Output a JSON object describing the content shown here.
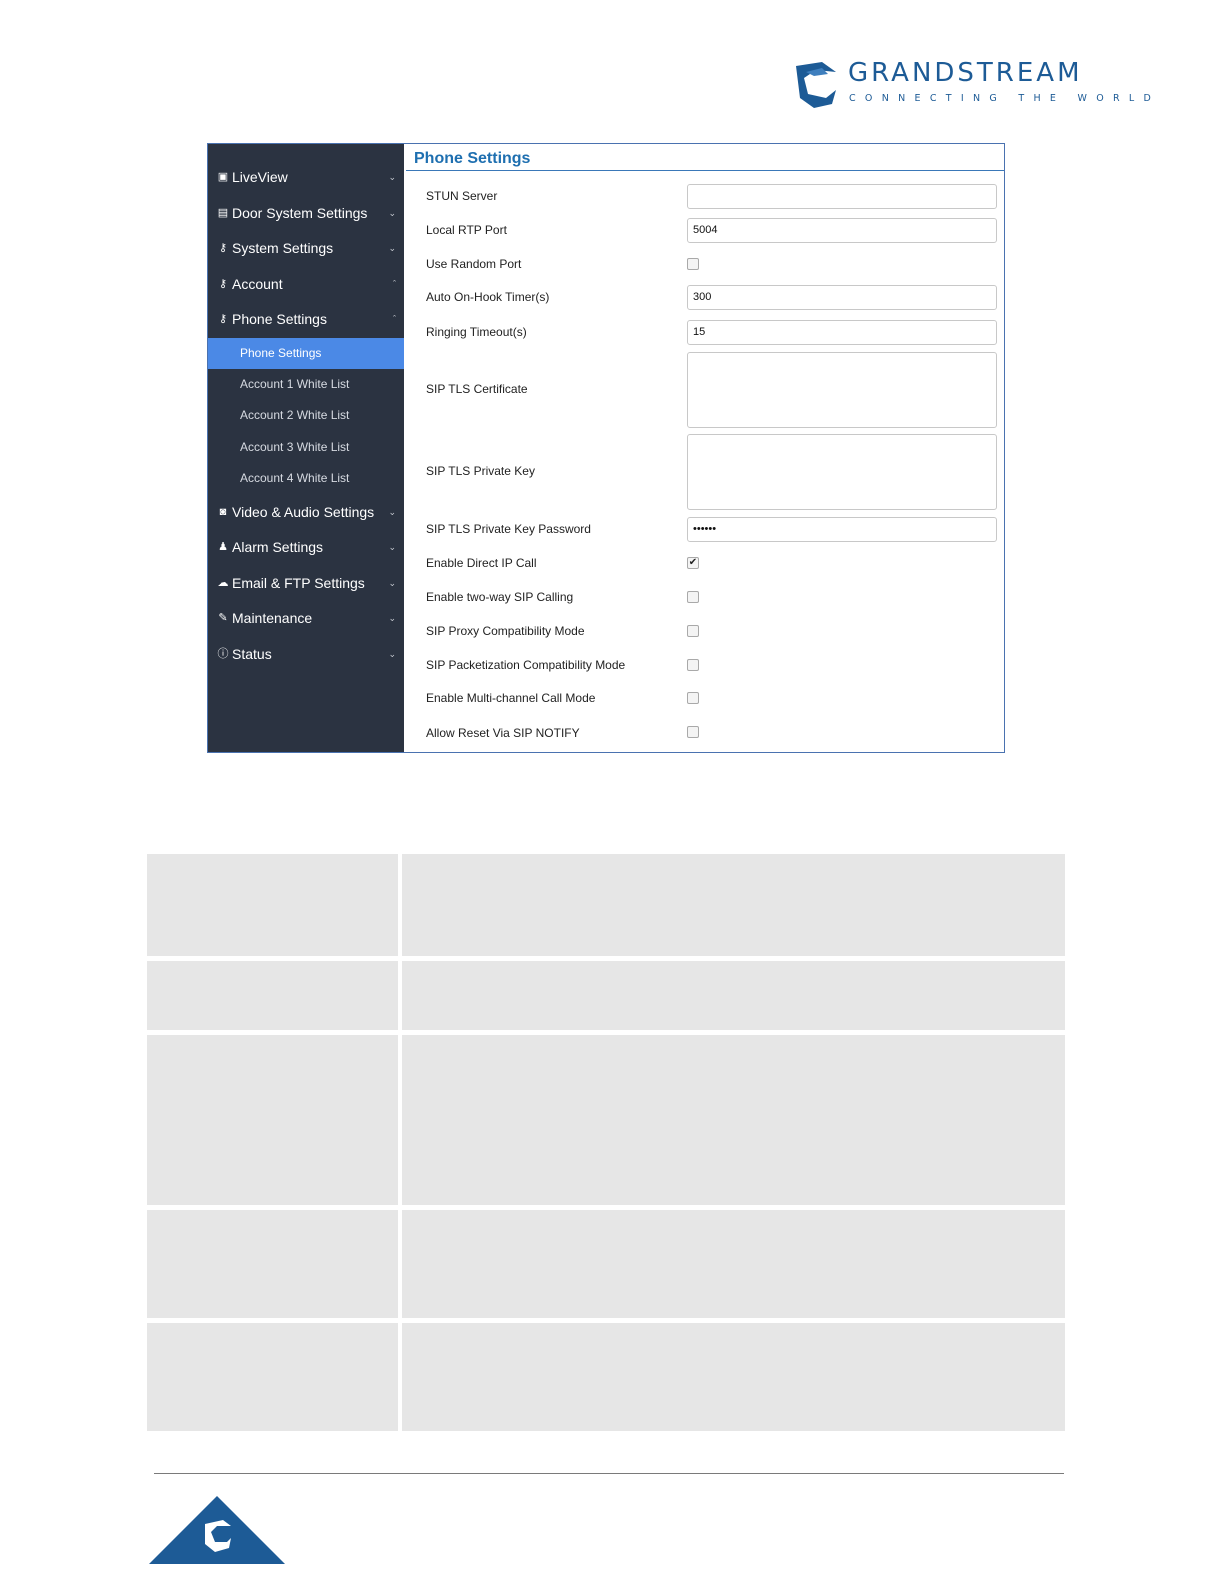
{
  "header": {
    "logo_word": "GRANDSTREAM",
    "logo_tagline": "CONNECTING THE WORLD",
    "brand_color": "#1d5b96"
  },
  "sidebar": {
    "bg_color": "#2b3341",
    "active_color": "#4b89e6",
    "items": [
      {
        "label": "LiveView",
        "icon": "video-icon",
        "expanded": false
      },
      {
        "label": "Door System Settings",
        "icon": "card-icon",
        "expanded": false
      },
      {
        "label": "System Settings",
        "icon": "key-icon",
        "expanded": false
      },
      {
        "label": "Account",
        "icon": "key-icon",
        "expanded": true
      },
      {
        "label": "Phone Settings",
        "icon": "key-icon",
        "expanded": true
      },
      {
        "label": "Video & Audio Settings",
        "icon": "camera-icon",
        "expanded": false
      },
      {
        "label": "Alarm Settings",
        "icon": "bell-icon",
        "expanded": false
      },
      {
        "label": "Email & FTP Settings",
        "icon": "cloud-icon",
        "expanded": false
      },
      {
        "label": "Maintenance",
        "icon": "wrench-icon",
        "expanded": false
      },
      {
        "label": "Status",
        "icon": "info-icon",
        "expanded": false
      }
    ],
    "sub_items": [
      {
        "label": "Phone Settings",
        "active": true
      },
      {
        "label": "Account 1 White List",
        "active": false
      },
      {
        "label": "Account 2 White List",
        "active": false
      },
      {
        "label": "Account 3 White List",
        "active": false
      },
      {
        "label": "Account 4 White List",
        "active": false
      }
    ]
  },
  "panel": {
    "title": "Phone Settings",
    "fields": {
      "stun_server": {
        "label": "STUN Server",
        "value": ""
      },
      "local_rtp_port": {
        "label": "Local RTP Port",
        "value": "5004"
      },
      "use_random_port": {
        "label": "Use Random Port",
        "checked": false
      },
      "auto_on_hook": {
        "label": "Auto On-Hook Timer(s)",
        "value": "300"
      },
      "ringing_timeout": {
        "label": "Ringing Timeout(s)",
        "value": "15"
      },
      "sip_tls_cert": {
        "label": "SIP TLS Certificate",
        "value": ""
      },
      "sip_tls_key": {
        "label": "SIP TLS Private Key",
        "value": ""
      },
      "sip_tls_key_password": {
        "label": "SIP TLS Private Key Password",
        "value": "••••••"
      },
      "enable_direct_ip_call": {
        "label": "Enable Direct IP Call",
        "checked": true
      },
      "enable_two_way_sip": {
        "label": "Enable two-way SIP Calling",
        "checked": false
      },
      "sip_proxy_compat": {
        "label": "SIP Proxy Compatibility Mode",
        "checked": false
      },
      "sip_packetization_compat": {
        "label": "SIP Packetization Compatibility Mode",
        "checked": false
      },
      "enable_multichannel": {
        "label": "Enable Multi-channel Call Mode",
        "checked": false
      },
      "allow_reset_notify": {
        "label": "Allow Reset Via SIP NOTIFY",
        "checked": false
      }
    },
    "check_mark": "✔"
  }
}
